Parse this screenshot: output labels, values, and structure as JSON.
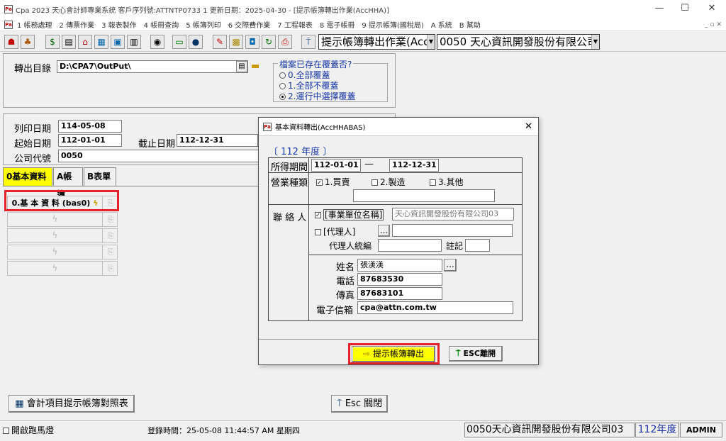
{
  "window": {
    "title": "Cpa 2023  天心會計師專業系統  客戶序列號:ATTNTP0733 1   更新日期：2025-04-30 - [提示帳簿轉出作業(AccHHA)]",
    "min": "—",
    "max": "☐",
    "close": "✕"
  },
  "menu": [
    "1 帳務處理",
    "2 傳票作業",
    "3 報表製作",
    "4 帳冊查詢",
    "5 帳簿列印",
    "6 交際費作業",
    "7 工程報表",
    "8 電子帳冊",
    "9 提示帳簿(國稅局)",
    "A 系統",
    "B 幫助"
  ],
  "toolbar": {
    "form_combo": "提示帳簿轉出作業(Acc",
    "company_combo": "0050  天心資訊開發股份有限公司"
  },
  "export": {
    "dir_label": "轉出目錄",
    "dir_value": "D:\\CPA7\\OutPut\\",
    "exists_legend": "檔案已存在覆蓋否?",
    "opt0": "0.全部覆蓋",
    "opt1": "1.全部不覆蓋",
    "opt2": "2.運行中選擇覆蓋",
    "selected": 2
  },
  "dates": {
    "print_label": "列印日期",
    "print_value": "114-05-08",
    "start_label": "起始日期",
    "start_value": "112-01-01",
    "end_label": "截止日期",
    "end_value": "112-12-31",
    "company_label": "公司代號",
    "company_value": "0050"
  },
  "tabs": [
    "0基本資料",
    "A帳簿",
    "B表單"
  ],
  "grid": {
    "first": "0.基 本 資 料 (bas0)"
  },
  "dialog": {
    "title": "基本資料轉出(AccHHABAS)",
    "year": "〔 112 年度 〕",
    "period_label": "所得期間",
    "period_from": "112-01-01",
    "period_dash": "—",
    "period_to": "112-12-31",
    "biz_label": "營業種類",
    "biz1": "1.買賣",
    "biz2": "2.製造",
    "biz3": "3.其他",
    "contact_label": "聯 絡 人",
    "unit_label": "[事業單位名稱]",
    "unit_value": "天心資訊開發股份有限公司03",
    "agent_label": "[代理人]",
    "agent_id_label": "代理人統編",
    "note_label": "註記",
    "name_label": "姓名",
    "name_value": "張渼渼",
    "tel_label": "電話",
    "tel_value": "87683530",
    "fax_label": "傳真",
    "fax_value": "87683101",
    "email_label": "電子信箱",
    "email_value": "cpa@attn.com.tw",
    "export_btn": "提示帳簿轉出",
    "esc_btn": "ESC離開",
    "ellipsis": "..."
  },
  "bottom": {
    "mapping_btn": "會計項目提示帳簿對照表",
    "close_btn": "Esc 關閉",
    "close_key": "E"
  },
  "status": {
    "marquee": "開啟跑馬燈",
    "login": "登錄時間：25-05-08 11:44:57 AM  星期四",
    "company": "0050天心資訊開發股份有限公司03",
    "year": "112年度",
    "user": "ADMIN"
  },
  "colors": {
    "highlight": "#ffff00",
    "red_frame": "#e8202a",
    "blue_text": "#1a3aa8",
    "year_blue": "#1a2ea0"
  }
}
